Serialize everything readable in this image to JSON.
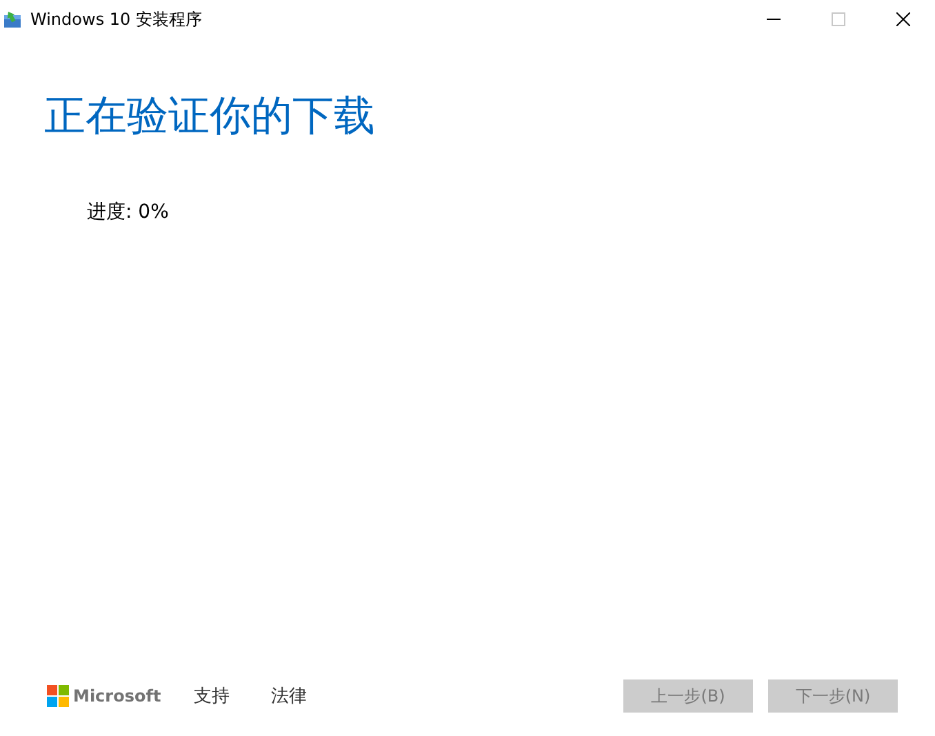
{
  "window": {
    "title": "Windows 10 安装程序",
    "controls": [
      {
        "kind": "minimize",
        "disabled": false
      },
      {
        "kind": "maximize",
        "disabled": true
      },
      {
        "kind": "close",
        "disabled": false
      }
    ]
  },
  "heading": "正在验证你的下载",
  "progress": "进度: 0%",
  "footer": {
    "brand": "Microsoft",
    "links": [
      "支持",
      "法律"
    ],
    "buttons": [
      {
        "label": "上一步(B)",
        "disabled": true
      },
      {
        "label": "下一步(N)",
        "disabled": true
      }
    ]
  }
}
